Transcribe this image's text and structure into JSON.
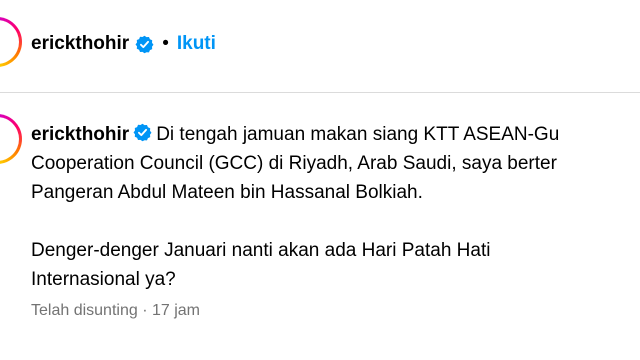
{
  "header": {
    "username": "erickthohir",
    "separator": "•",
    "follow_label": "Ikuti",
    "verified_icon": "verified-badge-icon"
  },
  "caption": {
    "username": "erickthohir",
    "lines": [
      "Di tengah jamuan makan siang KTT ASEAN-Gu",
      "Cooperation Council (GCC) di Riyadh, Arab Saudi, saya berter",
      "Pangeran Abdul Mateen bin Hassanal Bolkiah.",
      "Denger-denger Januari nanti akan ada Hari Patah Hati",
      "Internasional ya?"
    ]
  },
  "meta": {
    "edited_label": "Telah disunting",
    "separator": "·",
    "time": "17 jam"
  },
  "colors": {
    "accent": "#0095f6",
    "muted": "#737373",
    "divider": "#dbdbdb"
  }
}
